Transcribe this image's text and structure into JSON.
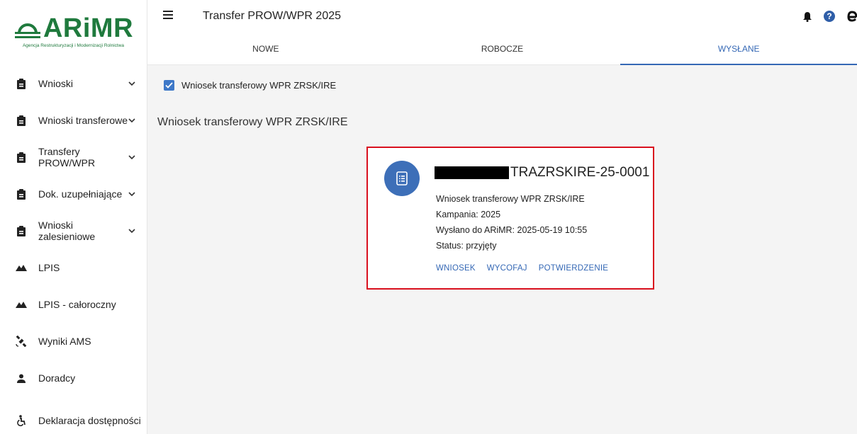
{
  "brand": {
    "name": "ARiMR",
    "subtitle": "Agencja Restrukturyzacji i Modernizacji Rolnictwa",
    "color": "#1f7a3d"
  },
  "sidebar": {
    "items": [
      {
        "label": "Wnioski",
        "icon": "clipboard-icon",
        "expandable": true
      },
      {
        "label": "Wnioski transferowe",
        "icon": "clipboard-icon",
        "expandable": true
      },
      {
        "label": "Transfery PROW/WPR",
        "icon": "clipboard-icon",
        "expandable": true
      },
      {
        "label": "Dok. uzupełniające",
        "icon": "clipboard-icon",
        "expandable": true
      },
      {
        "label": "Wnioski zalesieniowe",
        "icon": "clipboard-icon",
        "expandable": true
      },
      {
        "label": "LPIS",
        "icon": "terrain-icon",
        "expandable": false
      },
      {
        "label": "LPIS - całoroczny",
        "icon": "terrain-icon",
        "expandable": false
      },
      {
        "label": "Wyniki AMS",
        "icon": "satellite-icon",
        "expandable": false
      },
      {
        "label": "Doradcy",
        "icon": "person-icon",
        "expandable": false
      },
      {
        "label": "Deklaracja dostępności",
        "icon": "accessibility-icon",
        "expandable": false
      }
    ]
  },
  "header": {
    "title": "Transfer PROW/WPR 2025",
    "icons": [
      "bell-icon",
      "help-icon",
      "account-icon"
    ]
  },
  "tabs": [
    {
      "label": "NOWE",
      "active": false
    },
    {
      "label": "ROBOCZE",
      "active": false
    },
    {
      "label": "WYSŁANE",
      "active": true
    }
  ],
  "filter": {
    "checked": true,
    "label": "Wniosek transferowy WPR ZRSK/IRE"
  },
  "section_title": "Wniosek transferowy WPR ZRSK/IRE",
  "card": {
    "title_suffix": "TRAZRSKIRE-25-0001",
    "type": "Wniosek transferowy WPR ZRSK/IRE",
    "campaign": "Kampania: 2025",
    "sent": "Wysłano do ARiMR: 2025-05-19 10:55",
    "status": "Status: przyjęty",
    "actions": {
      "view": "WNIOSEK",
      "withdraw": "WYCOFAJ",
      "confirmation": "POTWIERDZENIE"
    }
  },
  "colors": {
    "accent": "#3568b5",
    "highlight_border": "#d9101e",
    "avatar": "#3d6fb8"
  }
}
